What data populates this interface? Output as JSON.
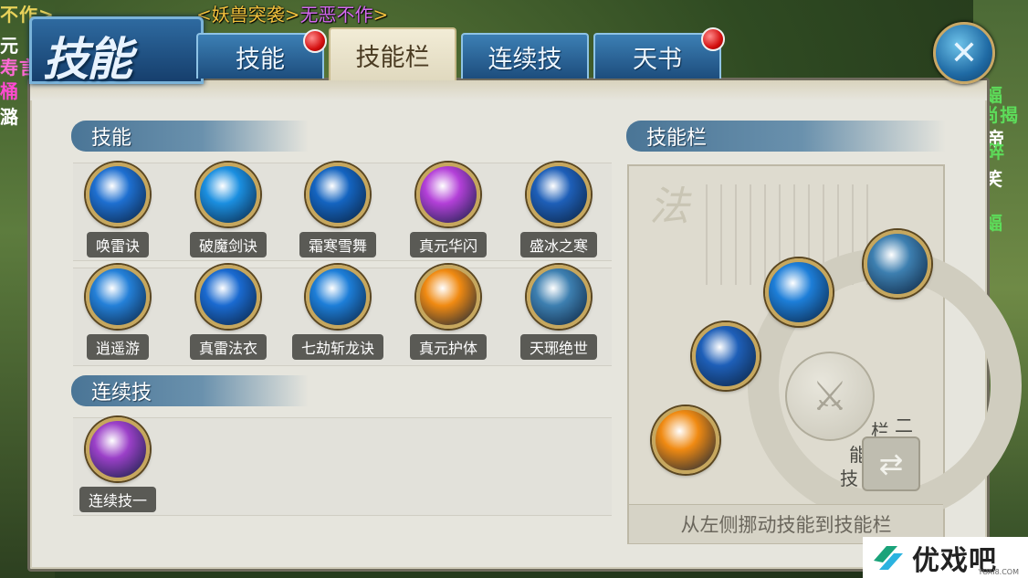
{
  "announcement": {
    "bracket_open": "<",
    "part1": "妖兽突袭",
    "mid": ">",
    "part2": "无恶不作",
    "bracket_close": ">"
  },
  "bg_left_texts": [
    "不作>",
    "元",
    "寿言",
    "桶",
    "潞"
  ],
  "bg_right_texts": [
    "蝠",
    "尚揭",
    "帝",
    "碎",
    "笑",
    "蝠"
  ],
  "window": {
    "title": "技能"
  },
  "tabs": [
    {
      "label": "技能",
      "has_dot": true
    },
    {
      "label": "技能栏",
      "has_dot": false,
      "active": true
    },
    {
      "label": "连续技",
      "has_dot": false
    },
    {
      "label": "天书",
      "has_dot": true
    }
  ],
  "close_label": "✕",
  "skills_section": {
    "title": "技能",
    "row1": [
      {
        "name": "唤雷诀",
        "icon": "lightning-icon",
        "color": "#1e6fd0"
      },
      {
        "name": "破魔剑诀",
        "icon": "sword-beam-icon",
        "color": "#1b8fe0"
      },
      {
        "name": "霜寒雪舞",
        "icon": "vortex-icon",
        "color": "#1464c0"
      },
      {
        "name": "真元华闪",
        "icon": "flash-icon",
        "color": "#b340d8"
      },
      {
        "name": "盛冰之寒",
        "icon": "ice-crystal-icon",
        "color": "#1e5fb8"
      }
    ],
    "row2": [
      {
        "name": "逍遥游",
        "icon": "wind-icon",
        "color": "#2480d8"
      },
      {
        "name": "真雷法衣",
        "icon": "thunder-robe-icon",
        "color": "#1a6ad0"
      },
      {
        "name": "七劫斩龙诀",
        "icon": "blade-fall-icon",
        "color": "#1d7ed8"
      },
      {
        "name": "真元护体",
        "icon": "shield-ring-icon",
        "color": "#f08a12"
      },
      {
        "name": "天琊绝世",
        "icon": "taiji-icon",
        "color": "#3d7fb0"
      }
    ]
  },
  "combo_section": {
    "title": "连续技",
    "items": [
      {
        "name": "连续技一",
        "icon": "crystal-combo-icon",
        "color": "#9b40c8"
      }
    ]
  },
  "bar_section": {
    "title": "技能栏",
    "deco_char": "法",
    "slots": [
      {
        "icon": "taiji-icon",
        "color": "#3d7fb0"
      },
      {
        "icon": "blade-fall-icon",
        "color": "#1d7ed8"
      },
      {
        "icon": "ice-crystal-icon",
        "color": "#1e5fb8"
      },
      {
        "icon": "shield-ring-icon",
        "color": "#f08a12"
      }
    ],
    "switch_chars": [
      "技",
      "能",
      "栏",
      "二"
    ],
    "hint": "从左侧挪动技能到技能栏"
  },
  "logo": {
    "text": "优戏吧",
    "sub": "YOXI8.COM"
  }
}
